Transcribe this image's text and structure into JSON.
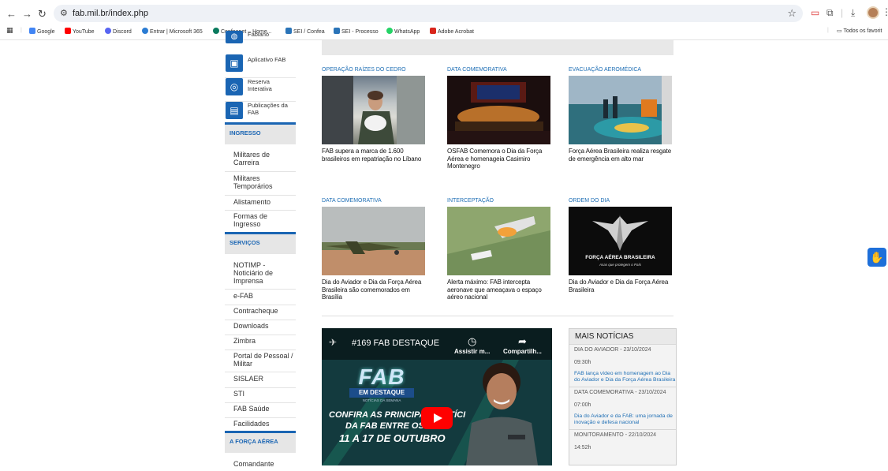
{
  "browser": {
    "url": "fab.mil.br/index.php",
    "bookmarks": [
      "Google",
      "YouTube",
      "Discord",
      "Entrar | Microsoft 365",
      "Confeanet – Home...",
      "SEI / Confea",
      "SEI - Processo",
      "WhatsApp",
      "Adobe Acrobat"
    ],
    "all_bookmarks": "Todos os favorit"
  },
  "sidebar": {
    "apps": [
      {
        "label": "Fabiano",
        "icon": "globe-icon"
      },
      {
        "label": "Aplicativo FAB",
        "icon": "app-icon"
      },
      {
        "label": "Reserva Interativa",
        "icon": "fingerprint-icon"
      },
      {
        "label": "Publicações da FAB",
        "icon": "document-icon"
      }
    ],
    "ingresso": {
      "title": "INGRESSO",
      "links": [
        "Militares de Carreira",
        "Militares Temporários",
        "Alistamento",
        "Formas de Ingresso"
      ]
    },
    "servicos": {
      "title": "SERVIÇOS",
      "links": [
        "NOTIMP - Noticiário de Imprensa",
        "e-FAB",
        "Contracheque",
        "Downloads",
        "Zimbra",
        "Portal de Pessoal / Militar",
        "SISLAER",
        "STI",
        "FAB Saúde",
        "Facilidades"
      ]
    },
    "aforca": {
      "title": "A FORÇA AÉREA",
      "links": [
        "Comandante"
      ]
    }
  },
  "news": [
    {
      "category": "OPERAÇÃO RAÍZES DO CEDRO",
      "title": "FAB supera a marca de 1.600 brasileiros em repatriação no Líbano"
    },
    {
      "category": "DATA COMEMORATIVA",
      "title": "OSFAB Comemora o Dia da Força Aérea e homenageia Casimiro Montenegro"
    },
    {
      "category": "EVACUAÇÃO AEROMÉDICA",
      "title": "Força Aérea Brasileira realiza resgate de emergência em alto mar"
    },
    {
      "category": "DATA COMEMORATIVA",
      "title": "Dia do Aviador e Dia da Força Aérea Brasileira são comemorados em Brasília"
    },
    {
      "category": "INTERCEPTAÇÃO",
      "title": "Alerta máximo: FAB intercepta aeronave que ameaçava o espaço aéreo nacional"
    },
    {
      "category": "ORDEM DO DIA",
      "title": "Dia do Aviador e Dia da Força Aérea Brasileira"
    }
  ],
  "emblem": {
    "line1": "FORÇA AÉREA BRASILEIRA",
    "line2": "Asas que protegem o País"
  },
  "video": {
    "title": "#169 FAB DESTAQUE",
    "watch_label": "Assistir m...",
    "share_label": "Compartilh...",
    "brand": "FAB",
    "brand_sub": "EM DESTAQUE",
    "brand_sub2": "NOTÍCIAS DA SEMANA",
    "line1": "CONFIRA AS PRINCIPAIS NOTÍCI",
    "line2": "DA FAB ENTRE OS DIAS",
    "line3": "11 A 17 DE OUTUBRO"
  },
  "more_news": {
    "title": "MAIS NOTÍCIAS",
    "items": [
      {
        "meta": "DIA DO AVIADOR - 23/10/2024",
        "time": "09:30h",
        "link": "FAB lança vídeo em homenagem ao Dia do Aviador e Dia da Força Aérea Brasileira"
      },
      {
        "meta": "DATA COMEMORATIVA - 23/10/2024",
        "time": "07:00h",
        "link": "Dia do Aviador e da FAB: uma jornada de inovação e defesa nacional"
      },
      {
        "meta": "MONITORAMENTO - 22/10/2024",
        "time": "14:52h",
        "link": ""
      }
    ]
  }
}
